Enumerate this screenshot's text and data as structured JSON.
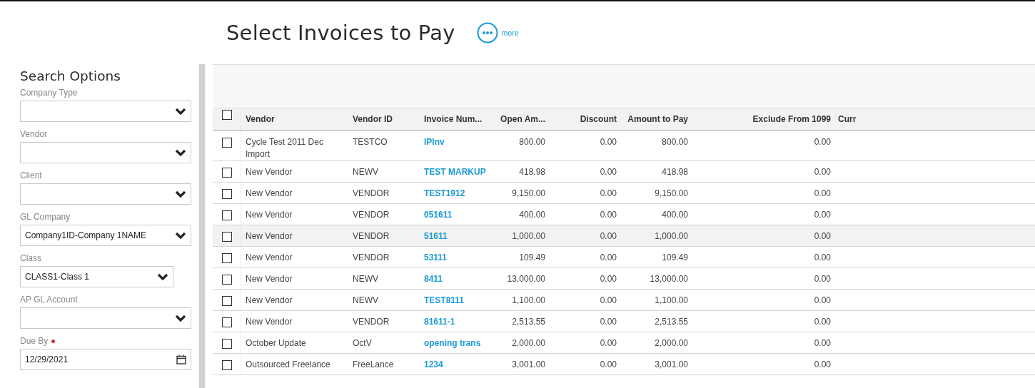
{
  "page": {
    "title": "Select Invoices to Pay",
    "more_label": "more"
  },
  "search_options": {
    "title": "Search Options",
    "fields": [
      {
        "label": "Company Type",
        "kind": "select",
        "required": false
      },
      {
        "label": "Vendor",
        "kind": "select",
        "required": false
      },
      {
        "label": "Client",
        "kind": "select",
        "required": false
      },
      {
        "label": "GL Company",
        "kind": "select",
        "required": false,
        "value": "Company1ID-Company 1NAME"
      },
      {
        "label": "Class",
        "kind": "select",
        "required": false,
        "value": "CLASS1-Class 1"
      },
      {
        "label": "AP GL Account",
        "kind": "select",
        "required": false
      },
      {
        "label": "Due By",
        "kind": "date",
        "required": true,
        "value": "12/29/2021"
      }
    ]
  },
  "table": {
    "select_all_checked": false,
    "columns": [
      "Vendor",
      "Vendor ID",
      "Invoice Num...",
      "Open Am...",
      "Discount",
      "Amount to Pay",
      "Exclude From 1099",
      "Curr"
    ],
    "rows": [
      {
        "checked": false,
        "highlighted": false,
        "vendor": "Cycle Test 2011 Dec Import",
        "vendor_id": "TESTCO",
        "invoice": "IPInv",
        "open_amount": "800.00",
        "discount": "0.00",
        "amount_to_pay": "800.00",
        "exclude_1099": "0.00"
      },
      {
        "checked": false,
        "highlighted": false,
        "vendor": "New Vendor",
        "vendor_id": "NEWV",
        "invoice": "TEST MARKUP",
        "open_amount": "418.98",
        "discount": "0.00",
        "amount_to_pay": "418.98",
        "exclude_1099": "0.00"
      },
      {
        "checked": false,
        "highlighted": false,
        "vendor": "New Vendor",
        "vendor_id": "VENDOR",
        "invoice": "TEST1912",
        "open_amount": "9,150.00",
        "discount": "0.00",
        "amount_to_pay": "9,150.00",
        "exclude_1099": "0.00"
      },
      {
        "checked": false,
        "highlighted": false,
        "vendor": "New Vendor",
        "vendor_id": "VENDOR",
        "invoice": "051611",
        "open_amount": "400.00",
        "discount": "0.00",
        "amount_to_pay": "400.00",
        "exclude_1099": "0.00"
      },
      {
        "checked": false,
        "highlighted": true,
        "vendor": "New Vendor",
        "vendor_id": "VENDOR",
        "invoice": "51611",
        "open_amount": "1,000.00",
        "discount": "0.00",
        "amount_to_pay": "1,000.00",
        "exclude_1099": "0.00"
      },
      {
        "checked": false,
        "highlighted": false,
        "vendor": "New Vendor",
        "vendor_id": "VENDOR",
        "invoice": "53111",
        "open_amount": "109.49",
        "discount": "0.00",
        "amount_to_pay": "109.49",
        "exclude_1099": "0.00"
      },
      {
        "checked": false,
        "highlighted": false,
        "vendor": "New Vendor",
        "vendor_id": "NEWV",
        "invoice": "8411",
        "open_amount": "13,000.00",
        "discount": "0.00",
        "amount_to_pay": "13,000.00",
        "exclude_1099": "0.00"
      },
      {
        "checked": false,
        "highlighted": false,
        "vendor": "New Vendor",
        "vendor_id": "NEWV",
        "invoice": "TEST8111",
        "open_amount": "1,100.00",
        "discount": "0.00",
        "amount_to_pay": "1,100.00",
        "exclude_1099": "0.00"
      },
      {
        "checked": false,
        "highlighted": false,
        "vendor": "New Vendor",
        "vendor_id": "VENDOR",
        "invoice": "81611-1",
        "open_amount": "2,513.55",
        "discount": "0.00",
        "amount_to_pay": "2,513.55",
        "exclude_1099": "0.00"
      },
      {
        "checked": false,
        "highlighted": false,
        "vendor": "October Update",
        "vendor_id": "OctV",
        "invoice": "opening trans",
        "open_amount": "2,000.00",
        "discount": "0.00",
        "amount_to_pay": "2,000.00",
        "exclude_1099": "0.00"
      },
      {
        "checked": false,
        "highlighted": false,
        "vendor": "Outsourced Freelance",
        "vendor_id": "FreeLance",
        "invoice": "1234",
        "open_amount": "3,001.00",
        "discount": "0.00",
        "amount_to_pay": "3,001.00",
        "exclude_1099": "0.00"
      }
    ]
  }
}
